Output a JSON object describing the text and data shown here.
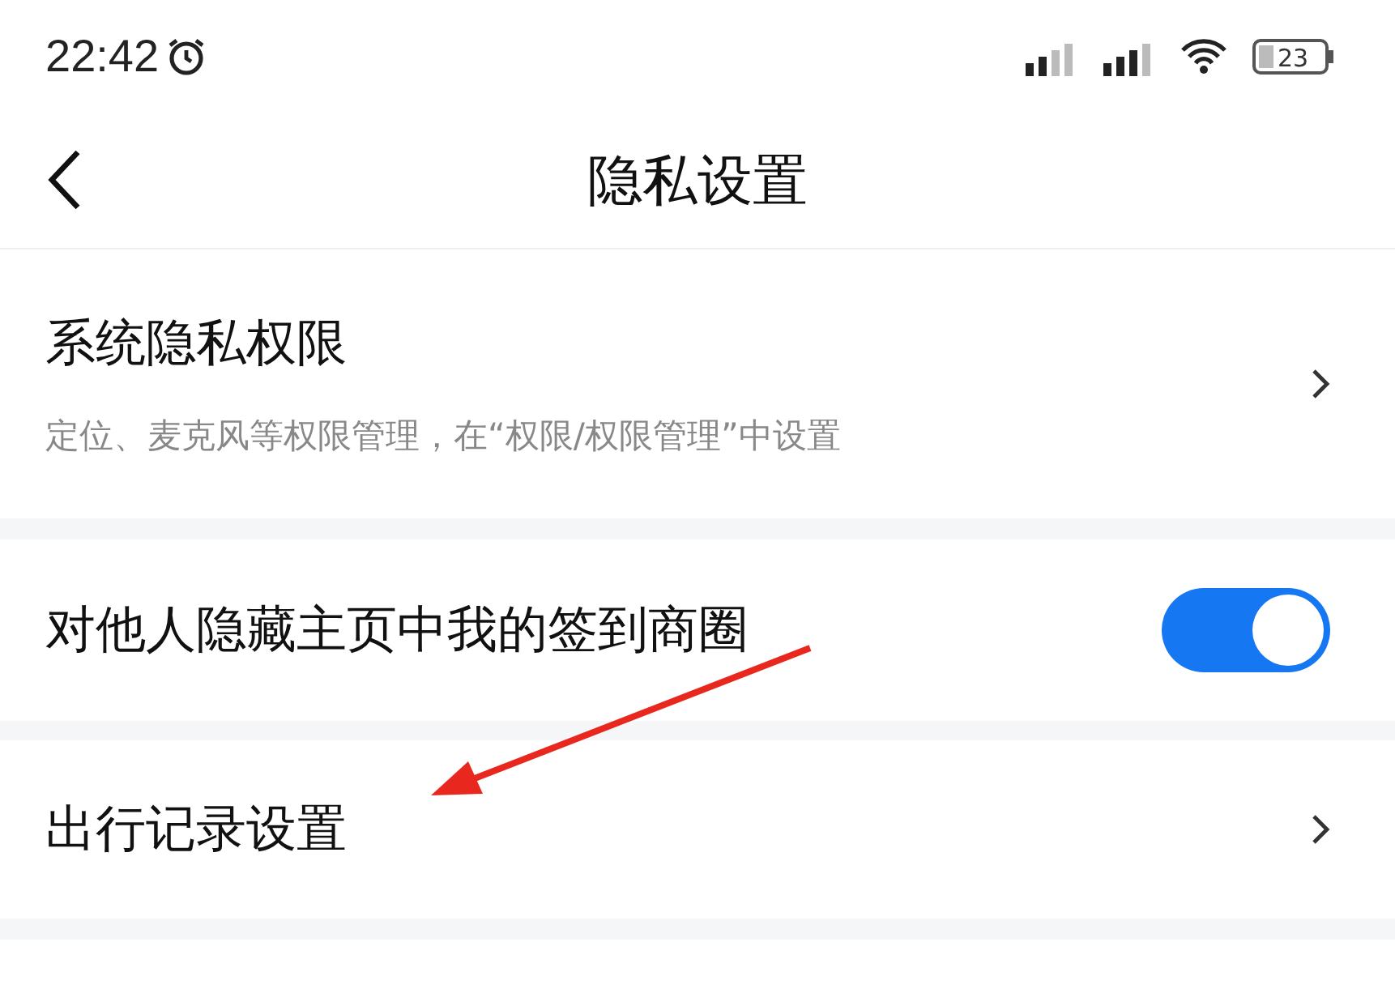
{
  "status_bar": {
    "time": "22:42",
    "battery": "23"
  },
  "nav": {
    "title": "隐私设置"
  },
  "rows": [
    {
      "kind": "link",
      "title": "系统隐私权限",
      "subtitle": "定位、麦克风等权限管理，在“权限/权限管理”中设置"
    },
    {
      "kind": "toggle",
      "title": "对他人隐藏主页中我的签到商圈",
      "on": true
    },
    {
      "kind": "link",
      "title": "出行记录设置"
    },
    {
      "kind": "cut"
    }
  ]
}
